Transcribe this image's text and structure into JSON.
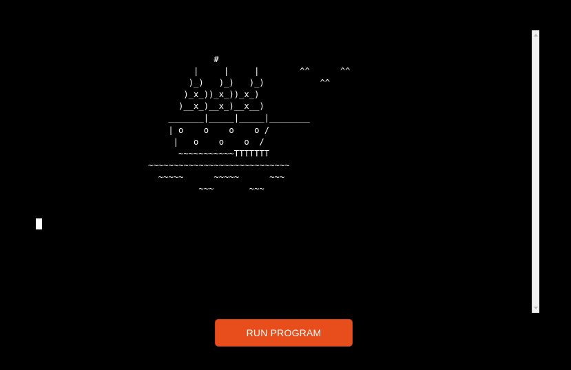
{
  "terminal": {
    "output": "             #\n         |     |     |        ^^      ^^\n        )_)   )_)   )_)           ^^\n       )_x_))_x_))_x_)\n      )__x_)__x_)__x__)\n    _______|_____|_____|________\n    | o    o    o    o /\n     |   o    o    o  /\n      ~~~~~~~~~~~TTTTTTT\n~~~~~~~~~~~~~~~~~~~~~~~~~~~~\n  ~~~~~      ~~~~~      ~~~\n          ~~~       ~~~"
  },
  "run_button": {
    "label": "RUN PROGRAM"
  },
  "colors": {
    "background": "#000000",
    "text": "#ffffff",
    "accent": "#e84e1b"
  }
}
